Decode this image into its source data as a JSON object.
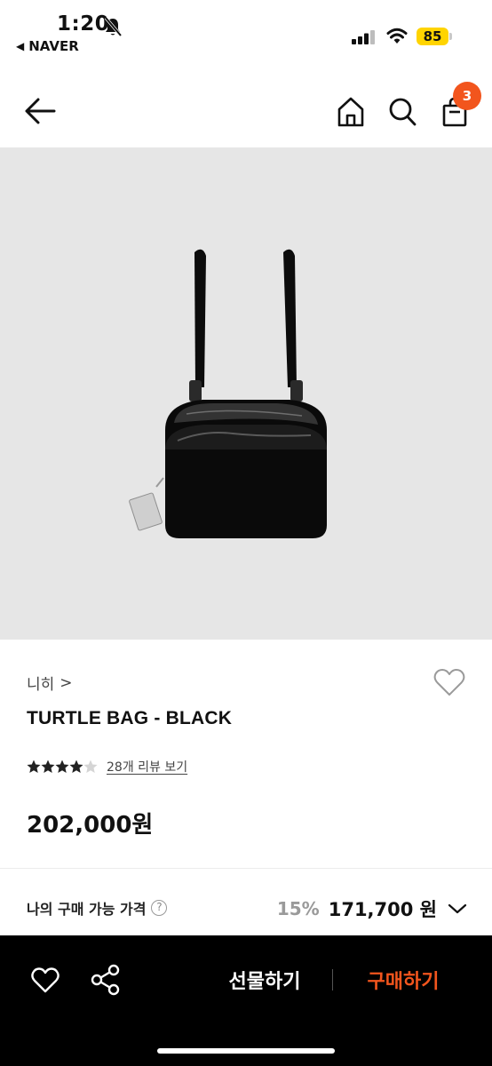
{
  "status_bar": {
    "time": "1:20",
    "back_app": "NAVER",
    "battery": "85"
  },
  "header": {
    "cart_count": "3"
  },
  "product": {
    "brand": "니히",
    "brand_chevron": ">",
    "title": "TURTLE BAG - BLACK",
    "rating": 4.5,
    "review_link": "28개 리뷰 보기",
    "price": "202,000원"
  },
  "my_price": {
    "label": "나의 구매 가능 가격",
    "help": "?",
    "discount": "15%",
    "price": "171,700 원"
  },
  "bottom_bar": {
    "gift_label": "선물하기",
    "buy_label": "구매하기"
  },
  "colors": {
    "accent": "#f2551d",
    "battery": "#ffd400",
    "image_bg": "#e6e6e6"
  }
}
